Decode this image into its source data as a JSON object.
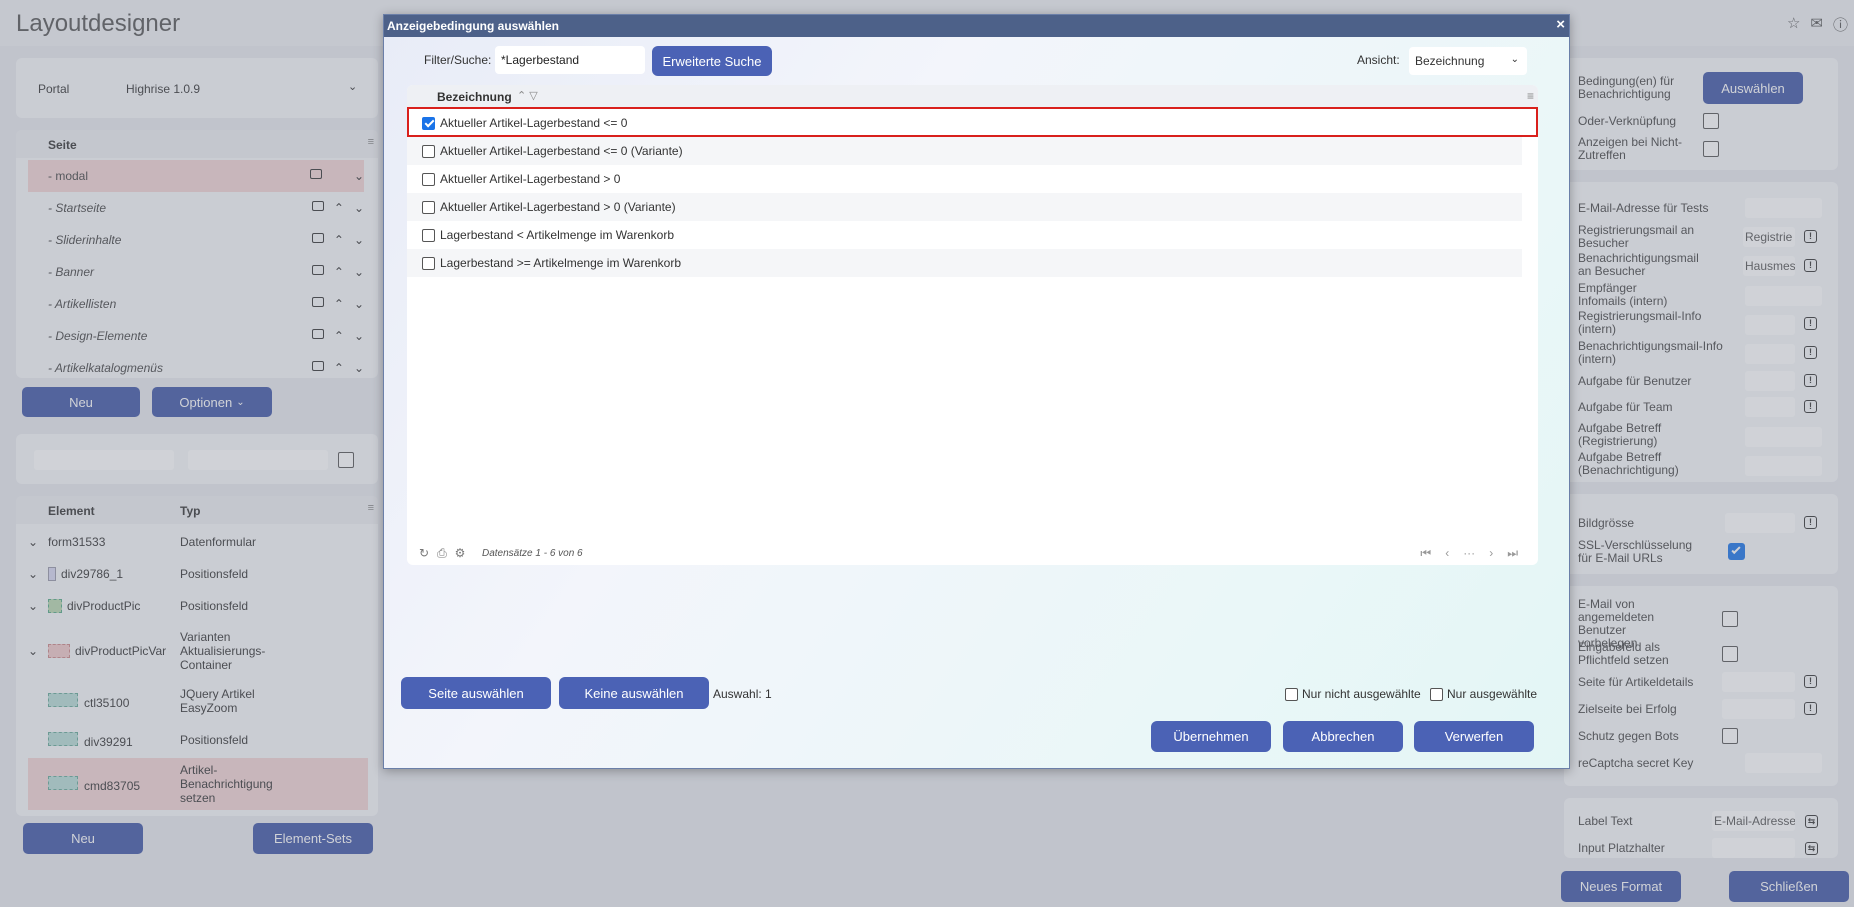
{
  "app": {
    "title": "Layoutdesigner",
    "portal_label": "Portal",
    "portal_value": "Highrise 1.0.9",
    "seite_header": "Seite",
    "pages": [
      "- modal",
      "- Startseite",
      "- Sliderinhalte",
      "- Banner",
      "- Artikellisten",
      "- Design-Elemente",
      "- Artikelkatalogmenüs"
    ],
    "btn_neu": "Neu",
    "btn_optionen": "Optionen",
    "elements_header": {
      "element": "Element",
      "typ": "Typ"
    },
    "elements": [
      {
        "name": "form31533",
        "type": "Datenformular"
      },
      {
        "name": "div29786_1",
        "type": "Positionsfeld"
      },
      {
        "name": "divProductPic",
        "type": "Positionsfeld"
      },
      {
        "name": "divProductPicVar",
        "type": "Varianten Aktualisierungs-Container"
      },
      {
        "name": "ctl35100",
        "type": "JQuery Artikel EasyZoom"
      },
      {
        "name": "div39291",
        "type": "Positionsfeld"
      },
      {
        "name": "cmd83705",
        "type": "Artikel-Benachrichtigung setzen"
      }
    ],
    "btn_neu2": "Neu",
    "btn_element_sets": "Element-Sets",
    "right": {
      "bedingung_label": "Bedingung(en) für Benachrichtigung",
      "auswaehlen": "Auswählen",
      "oder": "Oder-Verknüpfung",
      "anzeigen": "Anzeigen bei Nicht-Zutreffen",
      "email_tests": "E-Mail-Adresse für Tests",
      "reg_mail": "Registrierungsmail an Besucher",
      "reg_mail_val": "Registrie",
      "ben_mail": "Benachrichtigungsmail an Besucher",
      "ben_mail_val": "Hausmes",
      "empf": "Empfänger Infomails (intern)",
      "reg_info": "Registrierungsmail-Info (intern)",
      "ben_info": "Benachrichtigungsmail-Info (intern)",
      "aufgabe_benutzer": "Aufgabe für Benutzer",
      "aufgabe_team": "Aufgabe für Team",
      "betreff_reg": "Aufgabe Betreff (Registrierung)",
      "betreff_ben": "Aufgabe Betreff (Benachrichtigung)",
      "bildgroesse": "Bildgrösse",
      "ssl": "SSL-Verschlüsselung für E-Mail URLs",
      "email_angemeldet": "E-Mail von angemeldeten Benutzer vorbelegen",
      "pflichtfeld": "Eingabefeld als Pflichtfeld setzen",
      "seite_artikel": "Seite für Artikeldetails",
      "zielseite": "Zielseite bei Erfolg",
      "schutz": "Schutz gegen Bots",
      "recaptcha": "reCaptcha secret Key",
      "label_text": "Label Text",
      "label_text_val": "E-Mail-Adresse",
      "input_platzhalter": "Input Platzhalter",
      "neues_format": "Neues Format",
      "schliessen": "Schließen"
    }
  },
  "modal": {
    "title": "Anzeigebedingung auswählen",
    "close": "×",
    "filter_label": "Filter/Suche:",
    "filter_value": "*Lagerbestand",
    "adv_search": "Erweiterte Suche",
    "ansicht_label": "Ansicht:",
    "ansicht_value": "Bezeichnung",
    "column": "Bezeichnung",
    "rows": [
      {
        "label": "Aktueller Artikel-Lagerbestand <= 0",
        "checked": true
      },
      {
        "label": "Aktueller Artikel-Lagerbestand <= 0 (Variante)",
        "checked": false
      },
      {
        "label": "Aktueller Artikel-Lagerbestand > 0",
        "checked": false
      },
      {
        "label": "Aktueller Artikel-Lagerbestand > 0 (Variante)",
        "checked": false
      },
      {
        "label": "Lagerbestand < Artikelmenge im Warenkorb",
        "checked": false
      },
      {
        "label": "Lagerbestand >= Artikelmenge im Warenkorb",
        "checked": false
      }
    ],
    "records": "Datensätze 1 - 6 von 6",
    "seite_auswaehlen": "Seite auswählen",
    "keine_auswaehlen": "Keine auswählen",
    "auswahl": "Auswahl: 1",
    "nur_nicht": "Nur nicht ausgewählte",
    "nur_ausgewaehlte": "Nur ausgewählte",
    "uebernehmen": "Übernehmen",
    "abbrechen": "Abbrechen",
    "verwerfen": "Verwerfen"
  },
  "colors": {
    "accent": "#3f56a6",
    "titlebar": "#4d6189",
    "highlight": "#d9201c"
  }
}
